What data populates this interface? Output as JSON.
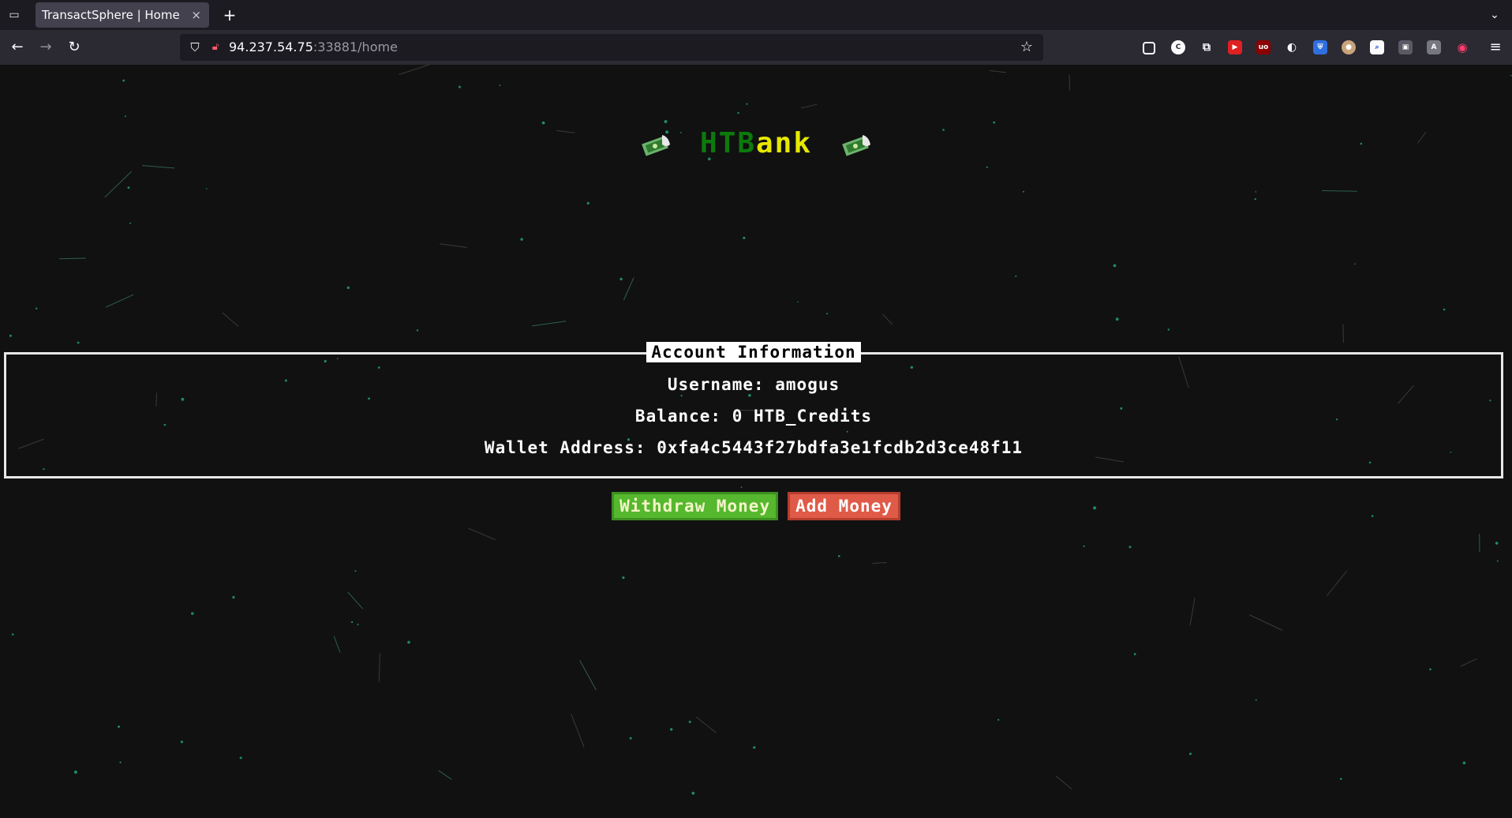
{
  "browser": {
    "tab_title": "TransactSphere | Home",
    "tab_close": "×",
    "new_tab": "+",
    "url_host": "94.237.54.75",
    "url_rest": ":33881/home"
  },
  "logo": {
    "part1": "HTB",
    "part2": "ank"
  },
  "account": {
    "title": "Account Information",
    "username_line": "Username: amogus",
    "balance_line": "Balance: 0 HTB_Credits",
    "wallet_line": "Wallet Address: 0xfa4c5443f27bdfa3e1fcdb2d3ce48f11"
  },
  "buttons": {
    "withdraw": "Withdraw Money",
    "add": "Add Money"
  },
  "colors": {
    "page_bg": "#111111",
    "logo_green": "#0c7a0c",
    "logo_yellow": "#e6e800",
    "withdraw_bg": "#55b82e",
    "add_bg": "#e05a48",
    "star": "#1f8a64"
  }
}
